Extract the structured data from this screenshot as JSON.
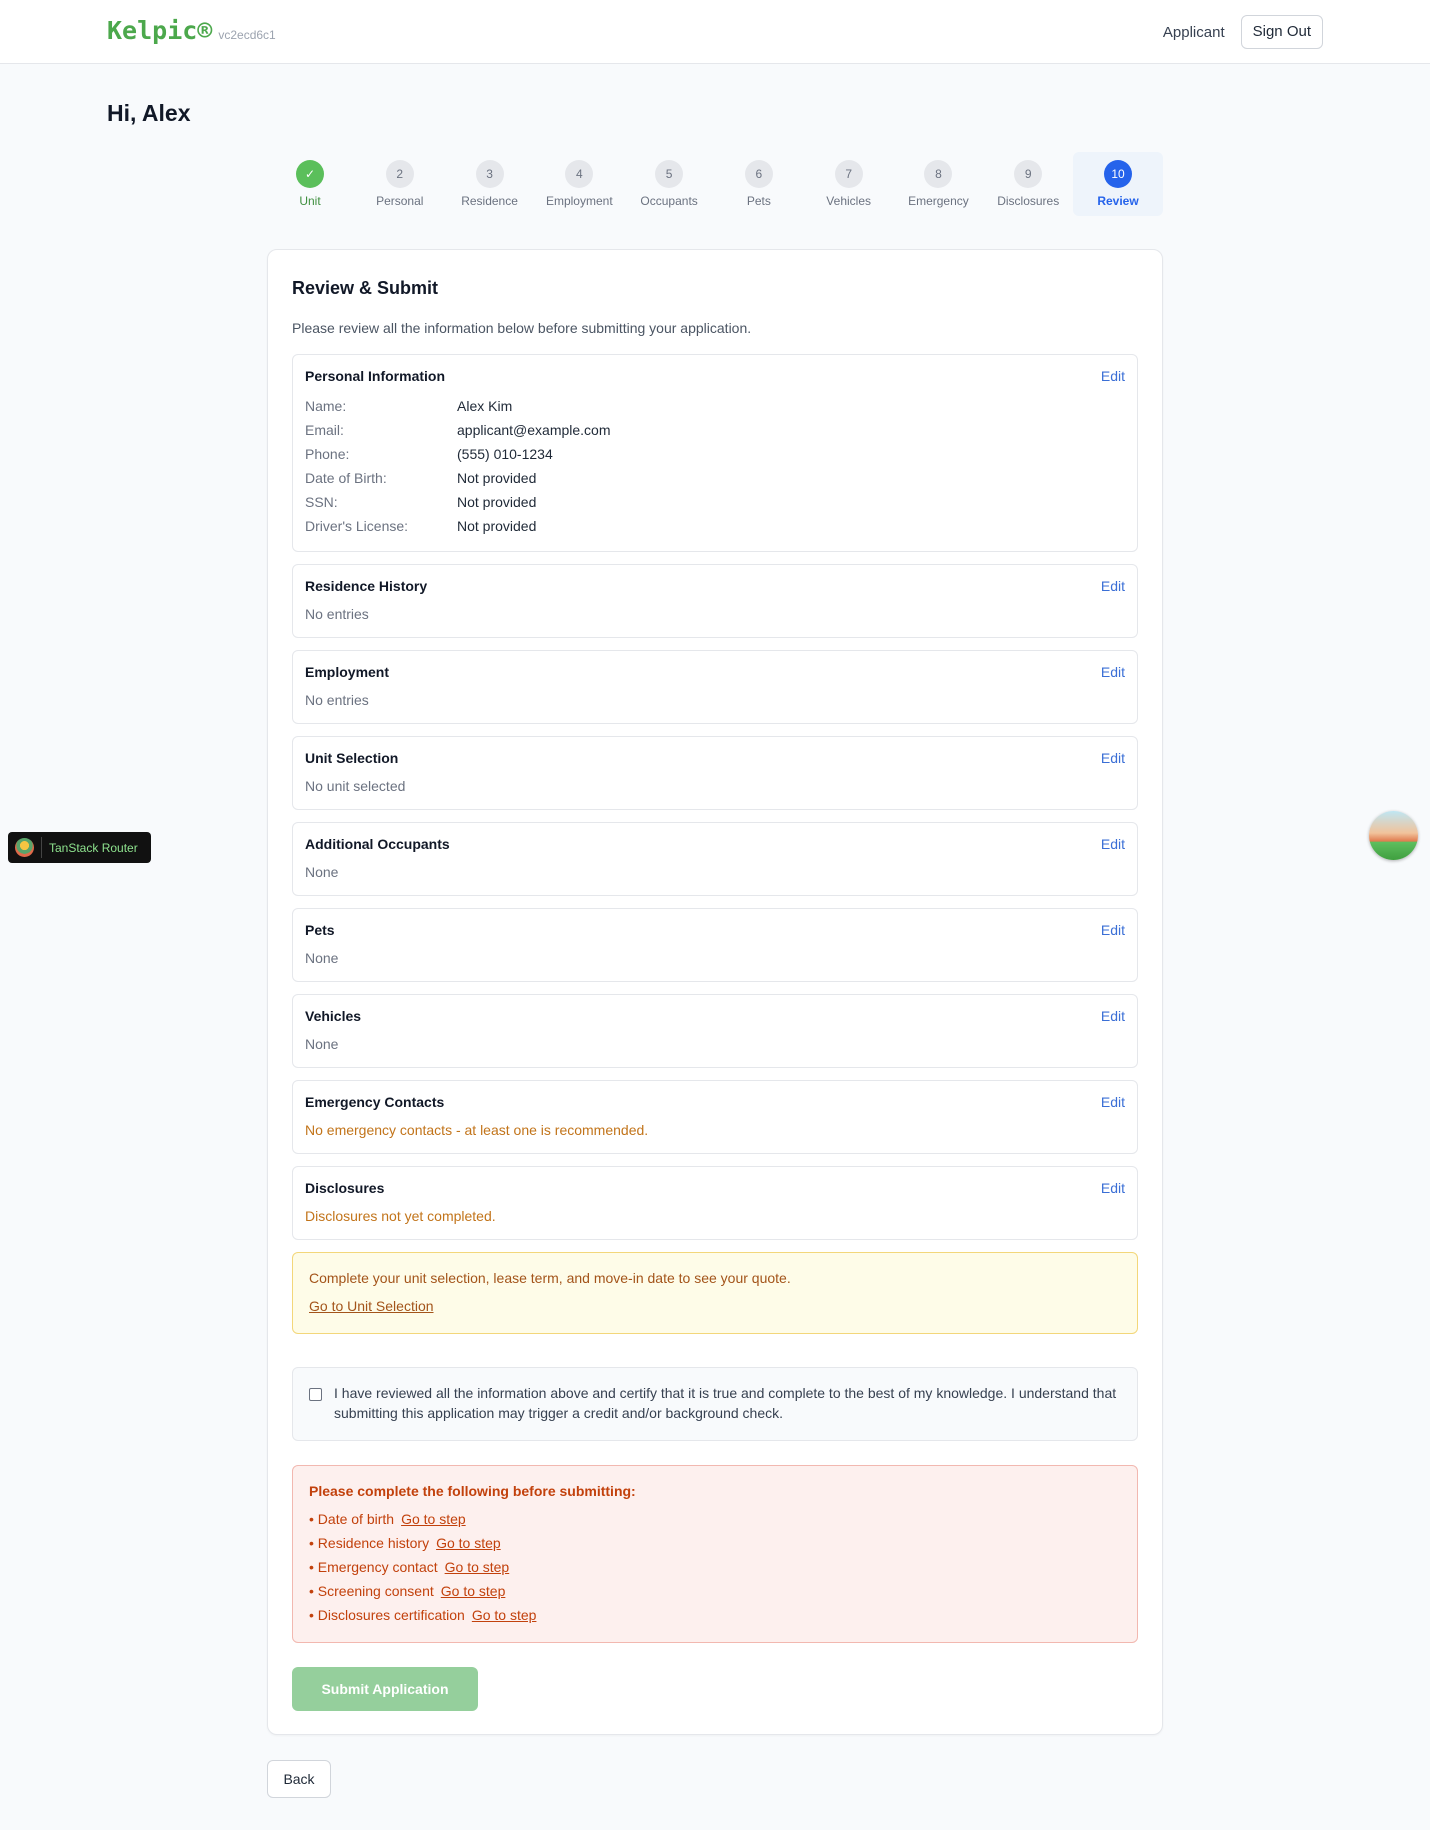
{
  "header": {
    "brand": "Kelpic®",
    "version": "vc2ecd6c1",
    "role": "Applicant",
    "sign_out": "Sign Out"
  },
  "greeting": "Hi, Alex",
  "steps": [
    {
      "num": "✓",
      "label": "Unit",
      "state": "done"
    },
    {
      "num": "2",
      "label": "Personal",
      "state": "todo"
    },
    {
      "num": "3",
      "label": "Residence",
      "state": "todo"
    },
    {
      "num": "4",
      "label": "Employment",
      "state": "todo"
    },
    {
      "num": "5",
      "label": "Occupants",
      "state": "todo"
    },
    {
      "num": "6",
      "label": "Pets",
      "state": "todo"
    },
    {
      "num": "7",
      "label": "Vehicles",
      "state": "todo"
    },
    {
      "num": "8",
      "label": "Emergency",
      "state": "todo"
    },
    {
      "num": "9",
      "label": "Disclosures",
      "state": "todo"
    },
    {
      "num": "10",
      "label": "Review",
      "state": "active"
    }
  ],
  "review": {
    "title": "Review & Submit",
    "intro": "Please review all the information below before submitting your application.",
    "edit_label": "Edit",
    "personal": {
      "title": "Personal Information",
      "rows": [
        {
          "label": "Name:",
          "value": "Alex Kim"
        },
        {
          "label": "Email:",
          "value": "applicant@example.com"
        },
        {
          "label": "Phone:",
          "value": "(555) 010-1234"
        },
        {
          "label": "Date of Birth:",
          "value": "Not provided"
        },
        {
          "label": "SSN:",
          "value": "Not provided"
        },
        {
          "label": "Driver's License:",
          "value": "Not provided"
        }
      ]
    },
    "sections": [
      {
        "title": "Residence History",
        "text": "No entries",
        "warn": false
      },
      {
        "title": "Employment",
        "text": "No entries",
        "warn": false
      },
      {
        "title": "Unit Selection",
        "text": "No unit selected",
        "warn": false
      },
      {
        "title": "Additional Occupants",
        "text": "None",
        "warn": false
      },
      {
        "title": "Pets",
        "text": "None",
        "warn": false
      },
      {
        "title": "Vehicles",
        "text": "None",
        "warn": false
      },
      {
        "title": "Emergency Contacts",
        "text": "No emergency contacts - at least one is recommended.",
        "warn": true
      },
      {
        "title": "Disclosures",
        "text": "Disclosures not yet completed.",
        "warn": true
      }
    ],
    "quote_notice": {
      "text": "Complete your unit selection, lease term, and move-in date to see your quote.",
      "link": "Go to Unit Selection"
    },
    "certification": "I have reviewed all the information above and certify that it is true and complete to the best of my knowledge. I understand that submitting this application may trigger a credit and/or background check.",
    "missing": {
      "title": "Please complete the following before submitting:",
      "link_label": "Go to step",
      "items": [
        "• Date of birth",
        "• Residence history",
        "• Emergency contact",
        "• Screening consent",
        "• Disclosures certification"
      ]
    },
    "submit": "Submit Application"
  },
  "back": "Back",
  "devtools": {
    "label": "TanStack Router"
  },
  "colors": {
    "brand": "#4ca84c",
    "accent": "#2563eb",
    "link": "#3b6fd6",
    "warning": "#c2741a",
    "error": "#c2410c",
    "submit_disabled": "#95cf9c"
  }
}
